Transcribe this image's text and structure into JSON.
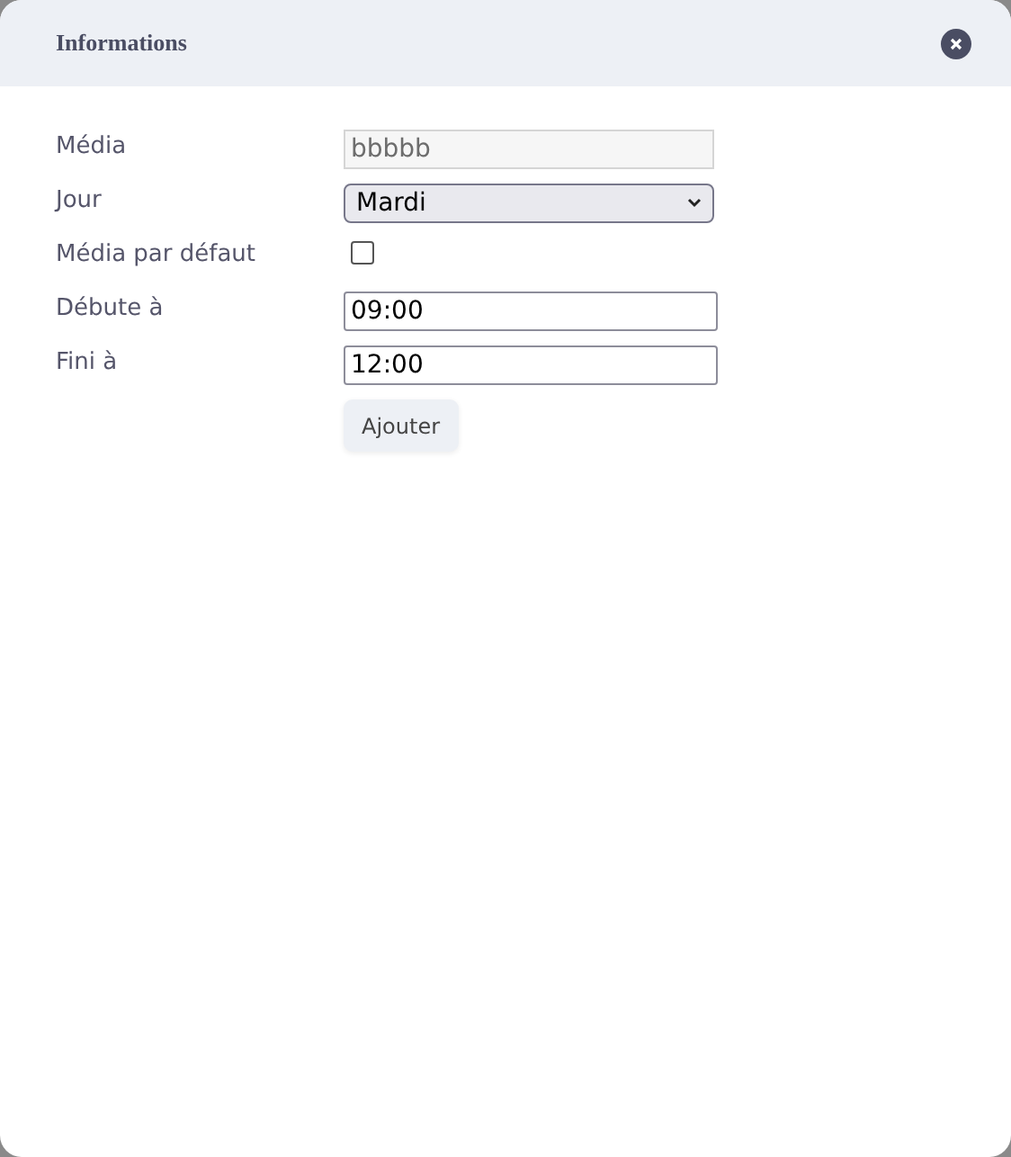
{
  "dialog": {
    "title": "Informations"
  },
  "fields": [
    {
      "label": "Média",
      "kind": "text",
      "value": "bbbbb",
      "disabled": true
    },
    {
      "label": "Jour",
      "kind": "select",
      "value": "Mardi"
    },
    {
      "label": "Média par défaut",
      "kind": "checkbox",
      "checked": false
    },
    {
      "label": "Débute à",
      "kind": "text",
      "value": "09:00",
      "disabled": false
    },
    {
      "label": "Fini à",
      "kind": "text",
      "value": "12:00",
      "disabled": false
    }
  ],
  "submit": {
    "label": "Ajouter"
  }
}
